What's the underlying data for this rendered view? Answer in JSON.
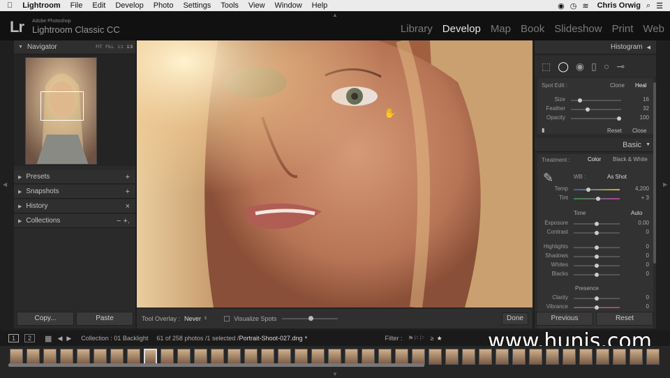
{
  "menubar": {
    "apple": "",
    "items": [
      "Lightroom",
      "File",
      "Edit",
      "Develop",
      "Photo",
      "Settings",
      "Tools",
      "View",
      "Window",
      "Help"
    ],
    "user": "Chris Orwig"
  },
  "header": {
    "logo": "Lr",
    "brand_small": "Adobe Photoshop",
    "brand_big": "Lightroom Classic CC",
    "modules": [
      "Library",
      "Develop",
      "Map",
      "Book",
      "Slideshow",
      "Print",
      "Web"
    ],
    "active_module": "Develop"
  },
  "left": {
    "navigator": {
      "title": "Navigator",
      "zoom": [
        "FIT",
        "FILL",
        "1:1",
        "1:3"
      ]
    },
    "panels": [
      {
        "label": "Presets",
        "action": "+"
      },
      {
        "label": "Snapshots",
        "action": "+"
      },
      {
        "label": "History",
        "action": "×"
      },
      {
        "label": "Collections",
        "action": "− +."
      }
    ],
    "copy": "Copy...",
    "paste": "Paste"
  },
  "toolbar": {
    "overlay_label": "Tool Overlay :",
    "overlay_value": "Never",
    "visualize": "Visualize Spots",
    "done": "Done"
  },
  "right": {
    "histogram": "Histogram",
    "spot": {
      "label": "Spot Edit :",
      "clone": "Clone",
      "heal": "Heal",
      "sliders": [
        {
          "name": "Size",
          "value": "16",
          "pos": 0.15
        },
        {
          "name": "Feather",
          "value": "32",
          "pos": 0.32
        },
        {
          "name": "Opacity",
          "value": "100",
          "pos": 1.0
        }
      ],
      "reset": "Reset",
      "close": "Close"
    },
    "basic": {
      "title": "Basic",
      "treatment_label": "Treatment :",
      "color": "Color",
      "bw": "Black & White",
      "wb_label": "WB :",
      "wb_value": "As Shot",
      "temp": {
        "name": "Temp",
        "value": "4,200",
        "pos": 0.3
      },
      "tint": {
        "name": "Tint",
        "value": "+ 3",
        "pos": 0.53
      },
      "tone": "Tone",
      "auto": "Auto",
      "tone_sliders": [
        {
          "name": "Exposure",
          "value": "0.00",
          "pos": 0.5
        },
        {
          "name": "Contrast",
          "value": "0",
          "pos": 0.5
        }
      ],
      "tone_sliders2": [
        {
          "name": "Highlights",
          "value": "0",
          "pos": 0.5
        },
        {
          "name": "Shadows",
          "value": "0",
          "pos": 0.5
        },
        {
          "name": "Whites",
          "value": "0",
          "pos": 0.5
        },
        {
          "name": "Blacks",
          "value": "0",
          "pos": 0.5
        }
      ],
      "presence": "Presence",
      "presence_sliders": [
        {
          "name": "Clarity",
          "value": "0",
          "pos": 0.5
        },
        {
          "name": "Vibrance",
          "value": "0",
          "pos": 0.5
        }
      ]
    },
    "previous": "Previous",
    "reset": "Reset"
  },
  "filmbar": {
    "page1": "1",
    "page2": "2",
    "collection": "Collection : 01 Backlight",
    "count": "61 of 258 photos /1 selected /",
    "filename": "Portrait-Shoot-027.dng",
    "filter": "Filter :"
  },
  "watermark": "www.hunis.com",
  "colors": {
    "accent": "#e6e6e6",
    "panel": "#2a2a2a"
  }
}
